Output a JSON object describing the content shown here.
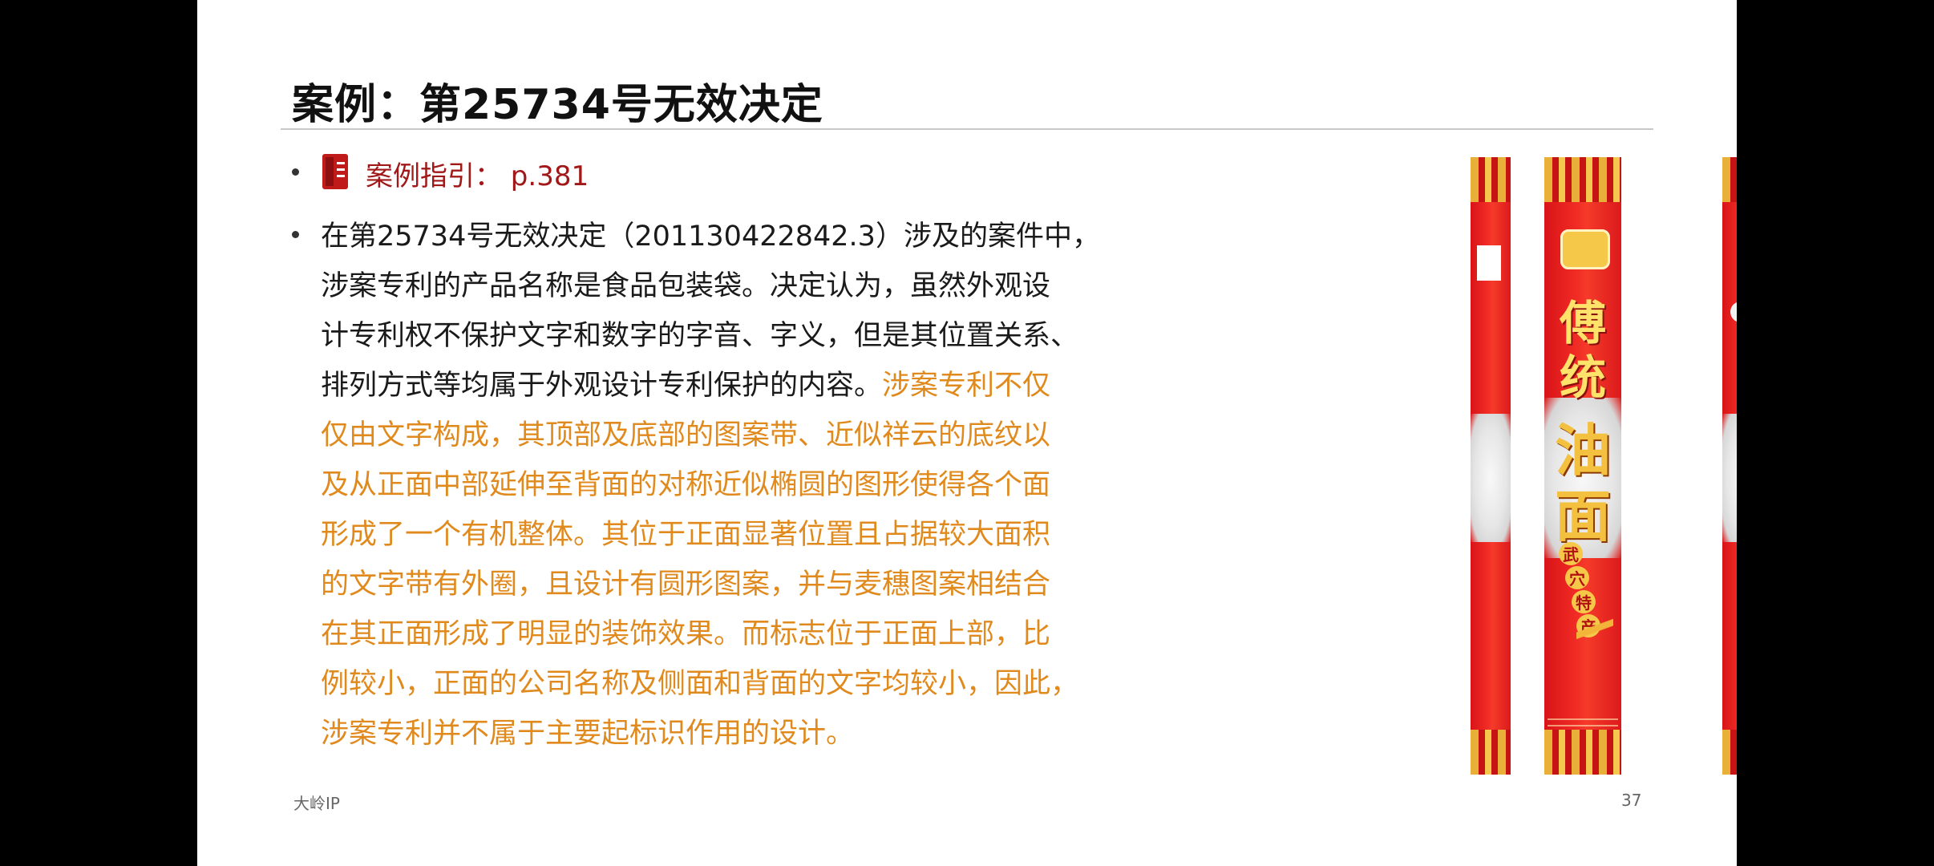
{
  "slide": {
    "title": "案例：第25734号无效决定",
    "case_ref": {
      "icon": "bookmark-icon",
      "text": "案例指引： p.381",
      "color": "#a01818"
    },
    "body_lines": [
      {
        "text": "在第25734号无效决定（201130422842.3）涉及的案件中，",
        "highlight": false
      },
      {
        "text": "涉案专利的产品名称是食品包装袋。决定认为，虽然外观设",
        "highlight": false
      },
      {
        "text": "计专利权不保护文字和数字的字音、字义，但是其位置关系、",
        "highlight": false
      },
      {
        "text_plain": "排列方式等均属于外观设计专利保护的内容。",
        "text_orange": "涉案专利不仅",
        "highlight": "mixed"
      },
      {
        "text": "仅由文字构成，其顶部及底部的图案带、近似祥云的底纹以",
        "highlight": true
      },
      {
        "text": "及从正面中部延伸至背面的对称近似椭圆的图形使得各个面",
        "highlight": true
      },
      {
        "text": "形成了一个有机整体。其位于正面显著位置且占据较大面积",
        "highlight": true
      },
      {
        "text": "的文字带有外圈，且设计有圆形图案，并与麦穗图案相结合",
        "highlight": true
      },
      {
        "text": "在其正面形成了明显的装饰效果。而标志位于正面上部，比",
        "highlight": true
      },
      {
        "text": "例较小，正面的公司名称及侧面和背面的文字均较小，因此，",
        "highlight": true
      },
      {
        "text": "涉案专利并不属于主要起标识作用的设计。",
        "highlight": true
      }
    ],
    "highlight_color": "#e08a1e",
    "footer_left": "大岭IP",
    "page_number": "37"
  },
  "package_image": {
    "front_chars": [
      "傅",
      "统",
      "油",
      "面"
    ],
    "badge_chars": [
      "武",
      "穴",
      "特",
      "产"
    ]
  }
}
